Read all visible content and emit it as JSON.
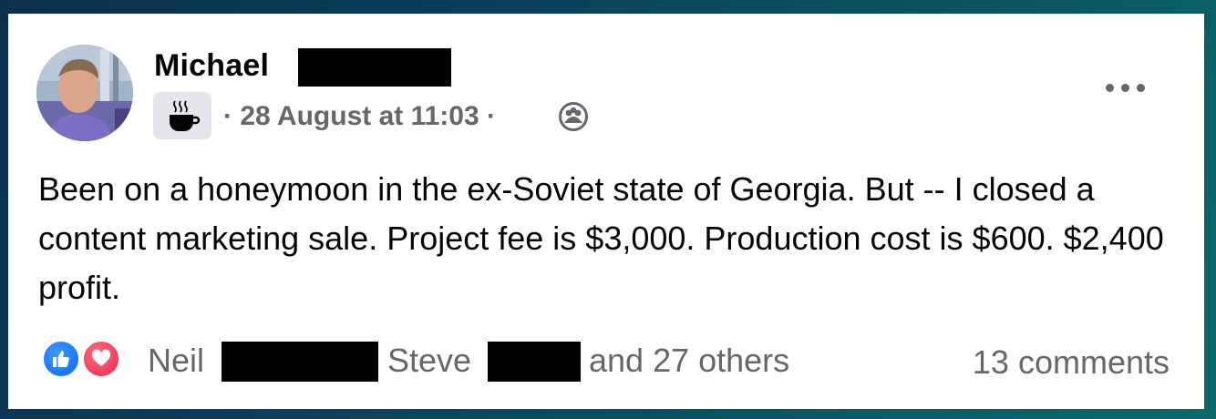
{
  "post": {
    "author_first_name": "Michael",
    "timestamp": "28 August at 11:03",
    "separator_before": "·",
    "separator_after": "·",
    "badge_icon": "coffee-cup-icon",
    "audience_icon": "friends-group-icon",
    "more_icon": "more-options-icon",
    "text": "Been on a honeymoon in the ex-Soviet state of Georgia. But -- I closed a content marketing sale. Project fee is $3,000. Production cost is $600. $2,400 profit.",
    "reactions": {
      "icons": [
        "like-icon",
        "love-icon"
      ],
      "name_1": "Neil",
      "name_2": "Steve",
      "others_text": "and 27 others",
      "like_color": "#0866ff",
      "love_color": "#f02849"
    },
    "comments_text": "13 comments"
  }
}
